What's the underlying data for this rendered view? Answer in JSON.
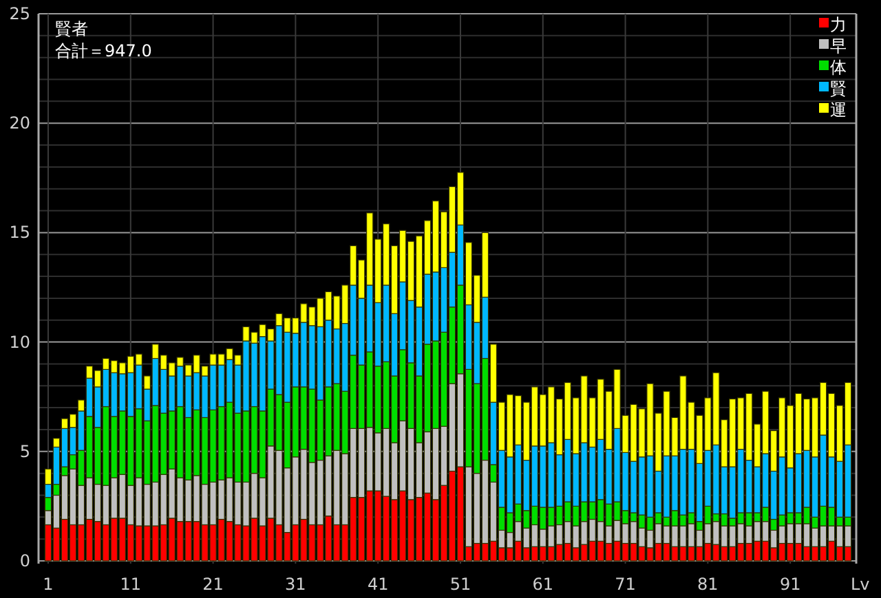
{
  "chart": {
    "total": "合計＝947.0",
    "chart_data": {
      "type": "bar",
      "stacked": true,
      "grid": true,
      "legend": true,
      "title": "賢者",
      "xlabel": "Lv",
      "xlim": [
        0,
        99
      ],
      "ylim": [
        0,
        25
      ],
      "xticks": [
        1,
        11,
        21,
        31,
        41,
        51,
        61,
        71,
        81,
        91
      ],
      "yticks": [
        0,
        5,
        10,
        15,
        20,
        25
      ],
      "x": [
        1,
        2,
        3,
        4,
        5,
        6,
        7,
        8,
        9,
        10,
        11,
        12,
        13,
        14,
        15,
        16,
        17,
        18,
        19,
        20,
        21,
        22,
        23,
        24,
        25,
        26,
        27,
        28,
        29,
        30,
        31,
        32,
        33,
        34,
        35,
        36,
        37,
        38,
        39,
        40,
        41,
        42,
        43,
        44,
        45,
        46,
        47,
        48,
        49,
        50,
        51,
        52,
        53,
        54,
        55,
        56,
        57,
        58,
        59,
        60,
        61,
        62,
        63,
        64,
        65,
        66,
        67,
        68,
        69,
        70,
        71,
        72,
        73,
        74,
        75,
        76,
        77,
        78,
        79,
        80,
        81,
        82,
        83,
        84,
        85,
        86,
        87,
        88,
        89,
        90,
        91,
        92,
        93,
        94,
        95,
        96,
        97,
        98
      ],
      "series": [
        {
          "name": "力",
          "color": "#ff0000",
          "values": [
            1.65,
            1.5,
            1.9,
            1.65,
            1.65,
            1.9,
            1.8,
            1.65,
            1.95,
            1.95,
            1.65,
            1.6,
            1.6,
            1.6,
            1.65,
            1.95,
            1.8,
            1.8,
            1.8,
            1.65,
            1.65,
            1.9,
            1.8,
            1.65,
            1.6,
            1.95,
            1.6,
            1.95,
            1.65,
            1.3,
            1.65,
            1.9,
            1.65,
            1.65,
            2.05,
            1.65,
            1.65,
            2.9,
            2.9,
            3.2,
            3.2,
            2.95,
            2.8,
            3.2,
            2.8,
            2.9,
            3.1,
            2.8,
            3.45,
            4.1,
            4.3,
            0.65,
            0.8,
            0.8,
            0.9,
            0.6,
            0.6,
            0.9,
            0.6,
            0.65,
            0.65,
            0.65,
            0.75,
            0.8,
            0.6,
            0.75,
            0.9,
            0.9,
            0.8,
            0.9,
            0.8,
            0.8,
            0.65,
            0.6,
            0.8,
            0.8,
            0.65,
            0.65,
            0.65,
            0.65,
            0.8,
            0.75,
            0.65,
            0.65,
            0.8,
            0.8,
            0.9,
            0.9,
            0.6,
            0.8,
            0.8,
            0.8,
            0.65,
            0.65,
            0.65,
            0.9,
            0.65,
            0.65
          ]
        },
        {
          "name": "早",
          "color": "#c0c0c0",
          "values": [
            0.65,
            1.5,
            2.0,
            2.55,
            1.8,
            1.9,
            1.7,
            1.8,
            1.85,
            2.0,
            1.8,
            2.2,
            1.9,
            2.0,
            2.3,
            2.25,
            2.0,
            1.9,
            2.1,
            1.85,
            1.95,
            1.8,
            2.0,
            1.95,
            2.0,
            2.05,
            2.2,
            3.3,
            3.4,
            2.95,
            3.1,
            3.2,
            2.85,
            2.95,
            2.75,
            3.4,
            3.25,
            3.15,
            3.15,
            2.9,
            2.65,
            3.1,
            2.6,
            3.2,
            3.25,
            2.5,
            2.8,
            3.25,
            2.7,
            4.0,
            4.25,
            3.65,
            3.2,
            3.8,
            2.7,
            0.8,
            0.7,
            0.9,
            0.9,
            1.0,
            0.8,
            0.95,
            0.9,
            1.0,
            1.0,
            1.05,
            1.0,
            0.9,
            0.8,
            0.95,
            0.9,
            1.0,
            0.85,
            0.8,
            0.9,
            0.8,
            0.95,
            0.95,
            1.05,
            0.75,
            0.9,
            1.05,
            0.95,
            0.95,
            0.9,
            0.8,
            0.9,
            0.9,
            0.8,
            0.8,
            0.9,
            0.9,
            1.05,
            0.85,
            0.95,
            0.7,
            0.95,
            0.95
          ]
        },
        {
          "name": "体",
          "color": "#00dd00",
          "values": [
            0.6,
            0.5,
            0.4,
            0.65,
            1.6,
            2.8,
            2.6,
            3.6,
            2.8,
            2.9,
            3.15,
            3.15,
            2.9,
            3.5,
            2.8,
            2.65,
            3.25,
            2.85,
            3.0,
            3.05,
            3.3,
            3.35,
            3.45,
            3.15,
            3.25,
            3.05,
            3.05,
            2.6,
            2.55,
            3.0,
            3.2,
            2.85,
            3.35,
            2.75,
            3.15,
            3.05,
            2.85,
            3.35,
            2.9,
            3.45,
            3.05,
            3.05,
            3.05,
            3.25,
            3.0,
            3.05,
            4.0,
            4.0,
            4.3,
            3.5,
            4.05,
            4.45,
            4.1,
            4.65,
            0.8,
            1.05,
            0.9,
            0.8,
            0.8,
            0.85,
            1.0,
            0.85,
            0.85,
            0.9,
            0.9,
            0.9,
            0.8,
            1.0,
            1.0,
            0.85,
            0.6,
            0.4,
            0.6,
            0.6,
            0.5,
            0.4,
            0.7,
            0.5,
            0.5,
            0.4,
            0.8,
            0.35,
            0.55,
            0.35,
            0.5,
            0.6,
            0.4,
            0.65,
            0.5,
            0.5,
            0.5,
            0.5,
            0.75,
            0.5,
            0.9,
            0.85,
            0.4,
            0.4
          ]
        },
        {
          "name": "賢",
          "color": "#00b8ff",
          "values": [
            0.6,
            1.7,
            1.75,
            1.25,
            1.8,
            1.75,
            1.85,
            1.7,
            2.0,
            1.7,
            2.0,
            2.0,
            1.45,
            2.15,
            2.0,
            1.6,
            1.85,
            1.9,
            1.7,
            1.9,
            2.05,
            1.9,
            1.95,
            2.2,
            3.2,
            2.9,
            3.4,
            2.2,
            3.15,
            3.2,
            2.45,
            2.95,
            2.9,
            3.35,
            3.05,
            2.5,
            3.1,
            3.2,
            3.05,
            3.05,
            2.9,
            3.5,
            2.85,
            3.1,
            2.85,
            3.15,
            3.2,
            3.15,
            2.95,
            2.5,
            2.75,
            2.95,
            2.8,
            2.8,
            2.85,
            2.6,
            2.55,
            2.7,
            2.3,
            2.75,
            2.8,
            2.95,
            2.35,
            2.85,
            2.4,
            2.7,
            2.5,
            2.75,
            2.5,
            3.35,
            2.65,
            2.35,
            2.65,
            2.8,
            1.9,
            2.8,
            2.5,
            3.0,
            2.9,
            2.65,
            2.55,
            3.15,
            2.15,
            2.35,
            2.9,
            2.4,
            2.1,
            2.45,
            2.2,
            2.65,
            2.05,
            2.7,
            2.6,
            2.75,
            3.25,
            2.3,
            2.55,
            3.3
          ]
        },
        {
          "name": "運",
          "color": "#ffff00",
          "values": [
            0.7,
            0.4,
            0.45,
            0.6,
            0.5,
            0.55,
            0.75,
            0.5,
            0.55,
            0.5,
            0.75,
            0.5,
            0.6,
            0.65,
            0.65,
            0.6,
            0.4,
            0.5,
            0.8,
            0.45,
            0.5,
            0.5,
            0.5,
            0.45,
            0.65,
            0.5,
            0.55,
            0.55,
            0.55,
            0.65,
            0.7,
            0.85,
            0.85,
            1.3,
            1.3,
            1.5,
            1.75,
            1.8,
            1.75,
            3.3,
            2.9,
            2.8,
            3.1,
            2.35,
            2.7,
            3.25,
            2.45,
            3.25,
            2.55,
            3.0,
            2.4,
            2.85,
            2.15,
            2.95,
            2.65,
            2.2,
            2.85,
            2.25,
            2.65,
            2.7,
            2.35,
            2.55,
            2.55,
            2.6,
            2.55,
            3.05,
            2.25,
            2.75,
            2.65,
            2.7,
            1.7,
            2.6,
            2.2,
            3.3,
            2.65,
            2.95,
            1.75,
            3.35,
            2.15,
            2.2,
            2.4,
            3.3,
            2.15,
            3.1,
            2.35,
            3.05,
            1.95,
            2.85,
            1.85,
            2.7,
            2.85,
            2.75,
            2.35,
            2.7,
            2.4,
            2.9,
            2.55,
            2.85
          ]
        }
      ]
    }
  }
}
